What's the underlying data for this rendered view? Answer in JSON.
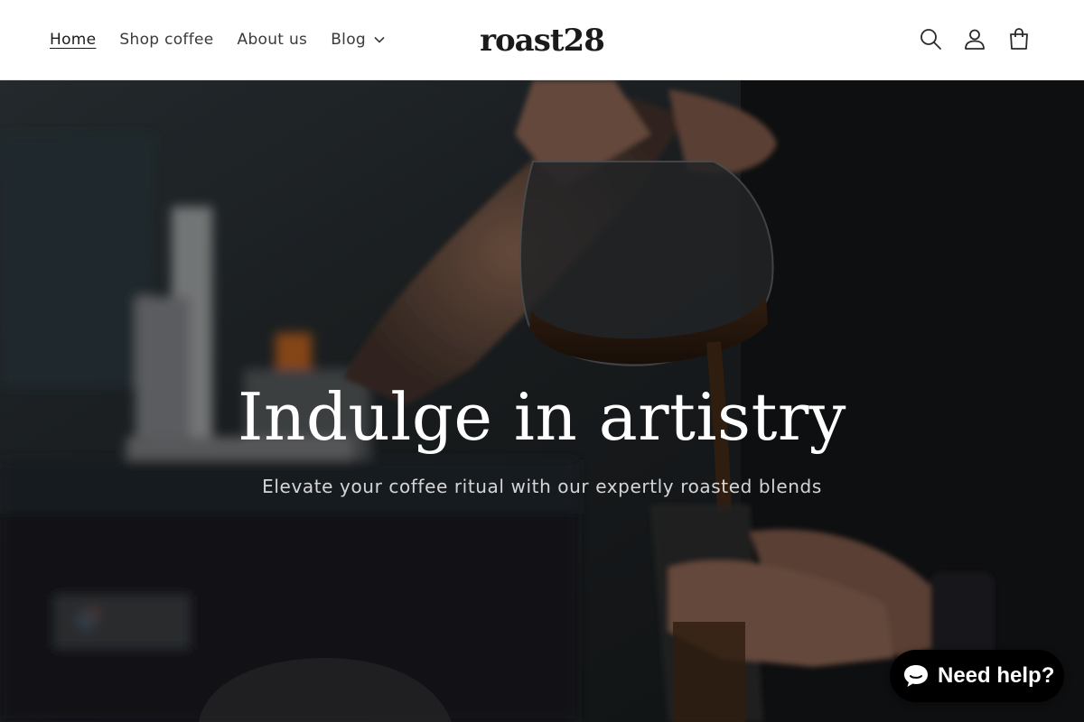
{
  "header": {
    "nav": [
      {
        "label": "Home",
        "active": true
      },
      {
        "label": "Shop coffee"
      },
      {
        "label": "About us"
      },
      {
        "label": "Blog",
        "has_dropdown": true
      }
    ],
    "logo_text": "roast28",
    "icons": [
      "search-icon",
      "account-icon",
      "cart-icon"
    ]
  },
  "hero": {
    "title": "Indulge in artistry",
    "subtitle": "Elevate your coffee ritual with our expertly roasted blends"
  },
  "chat": {
    "label": "Need help?",
    "icon": "chat-bubble-icon"
  },
  "colors": {
    "text": "#1a1a1a",
    "nav_text": "#3a3a3a",
    "hero_bg": "#1b1d1f",
    "chat_bg": "#000000"
  }
}
